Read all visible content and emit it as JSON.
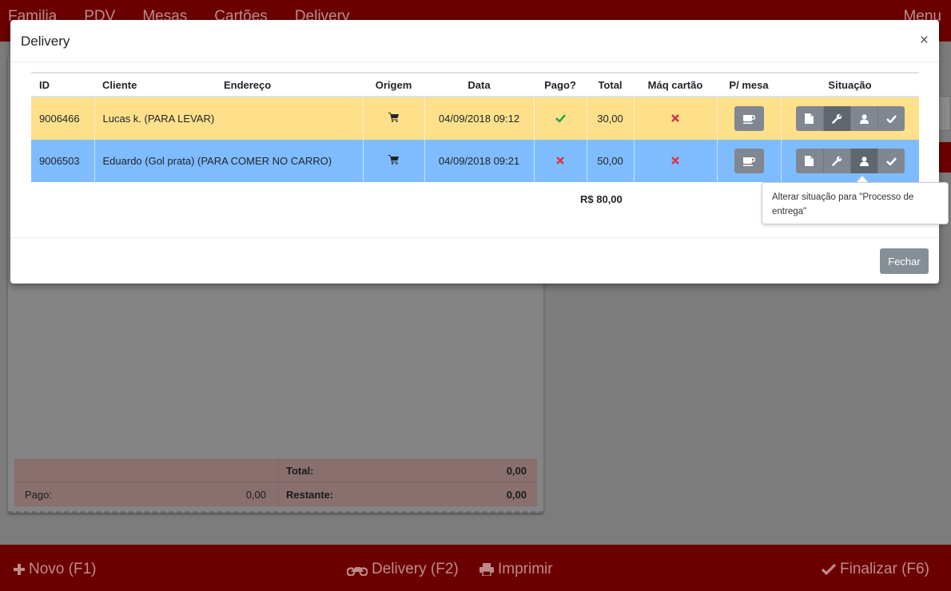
{
  "topbar": {
    "nav": [
      "Familia",
      "PDV",
      "Mesas",
      "Cartões",
      "Delivery"
    ],
    "right": "Menu"
  },
  "modal": {
    "title": "Delivery",
    "close": "×",
    "columns": [
      "ID",
      "Cliente",
      "Endereço",
      "Origem",
      "Data",
      "Pago?",
      "Total",
      "Máq cartão",
      "P/ mesa",
      "Situação"
    ],
    "rows": [
      {
        "id": "9006466",
        "cliente": "Lucas k. (PARA LEVAR)",
        "endereco": "",
        "origem_icon": "cart-icon",
        "data": "04/09/2018 09:12",
        "pago": true,
        "total": "30,00",
        "maq_cartao": false,
        "color": "#fee08b",
        "active_status": 1
      },
      {
        "id": "9006503",
        "cliente": "Eduardo (Gol prata) (PARA COMER NO CARRO)",
        "endereco": "",
        "origem_icon": "cart-icon",
        "data": "04/09/2018 09:21",
        "pago": false,
        "total": "50,00",
        "maq_cartao": false,
        "color": "#7fbcff",
        "active_status": 2
      }
    ],
    "total_label": "R$ 80,00",
    "tooltip": "Alterar situação para \"Processo de entrega\"",
    "close_button": "Fechar"
  },
  "ticket": {
    "total_label": "Total:",
    "total_value": "0,00",
    "paid_label": "Pago:",
    "paid_value": "0,00",
    "remaining_label": "Restante:",
    "remaining_value": "0,00"
  },
  "bottombar": {
    "new": "Novo (F1)",
    "delivery": "Delivery (F2)",
    "print": "Imprimir",
    "finish": "Finalizar (F6)"
  },
  "colors": {
    "brand": "#6b0000",
    "check_green": "#28a745",
    "cross_red": "#dc3545",
    "btn_gray": "#808790"
  }
}
